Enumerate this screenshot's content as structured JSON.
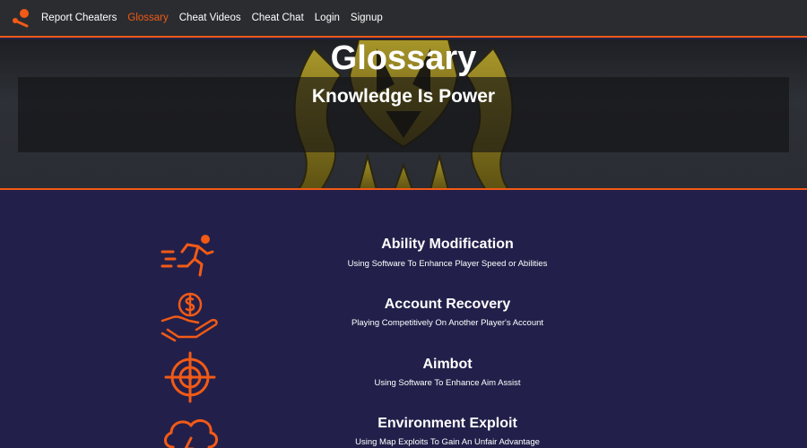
{
  "nav": {
    "links": [
      {
        "label": "Report Cheaters"
      },
      {
        "label": "Glossary"
      },
      {
        "label": "Cheat Videos"
      },
      {
        "label": "Cheat Chat"
      },
      {
        "label": "Login"
      },
      {
        "label": "Signup"
      }
    ],
    "active_index": 1
  },
  "hero": {
    "title": "Glossary",
    "subtitle": "Knowledge Is Power"
  },
  "glossary": {
    "items": [
      {
        "title": "Ability Modification",
        "description": "Using Software To Enhance Player Speed or Abilities",
        "icon": "running-man-icon"
      },
      {
        "title": "Account Recovery",
        "description": "Playing Competitively On Another Player's Account",
        "icon": "hand-coin-icon"
      },
      {
        "title": "Aimbot",
        "description": "Using Software To Enhance Aim Assist",
        "icon": "crosshair-icon"
      },
      {
        "title": "Environment Exploit",
        "description": "Using Map Exploits To Gain An Unfair Advantage",
        "icon": "cloud-lightning-icon"
      }
    ]
  },
  "colors": {
    "accent": "#f25a16",
    "nav_bg": "#2b2c30",
    "content_bg": "#22204a",
    "emblem": "#8a7a1c"
  }
}
